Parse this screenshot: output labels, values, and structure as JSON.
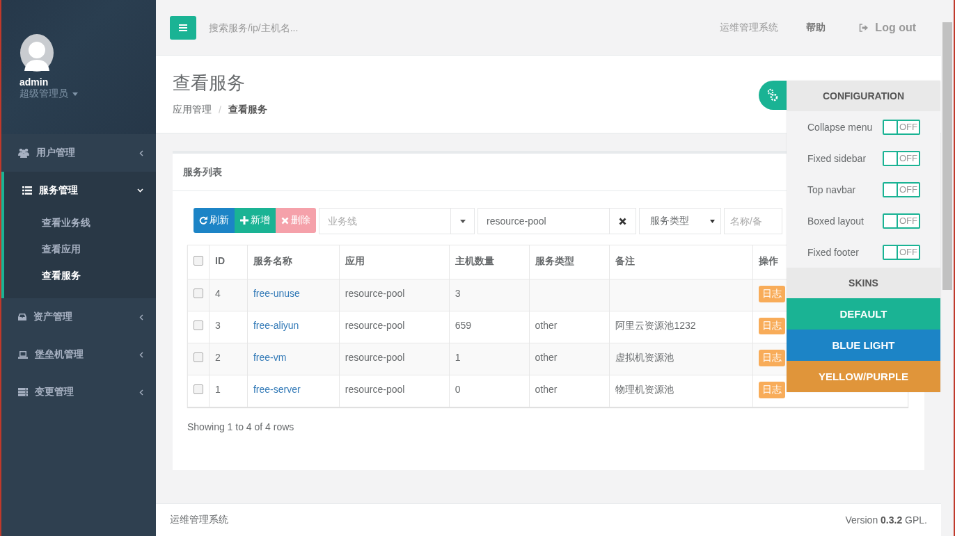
{
  "sidebar": {
    "user": {
      "name": "admin",
      "role": "超级管理员"
    },
    "menu": [
      {
        "label": "用户管理",
        "expanded": false,
        "selected": false
      },
      {
        "label": "服务管理",
        "expanded": true,
        "selected": true,
        "children": [
          {
            "label": "查看业务线",
            "selected": false
          },
          {
            "label": "查看应用",
            "selected": false
          },
          {
            "label": "查看服务",
            "selected": true
          }
        ]
      },
      {
        "label": "资产管理",
        "expanded": false,
        "selected": false
      },
      {
        "label": "堡垒机管理",
        "expanded": false,
        "selected": false
      },
      {
        "label": "变更管理",
        "expanded": false,
        "selected": false
      }
    ]
  },
  "topnav": {
    "search": {
      "placeholder": "搜索服务/ip/主机名..."
    },
    "links": [
      {
        "label": "运维管理系统",
        "kind": "text"
      },
      {
        "label": "帮助",
        "kind": "help"
      }
    ],
    "logout": "Log out"
  },
  "header": {
    "title": "查看服务",
    "separator": "/",
    "breadcrumb": [
      {
        "label": "应用管理",
        "active": false
      },
      {
        "label": "查看服务",
        "active": true
      }
    ]
  },
  "box": {
    "title": "服务列表",
    "buttons": [
      {
        "label": "刷新",
        "kind": "refresh",
        "disabled": false
      },
      {
        "label": "新增",
        "kind": "add",
        "disabled": false
      },
      {
        "label": "删除",
        "kind": "delete",
        "disabled": true
      }
    ],
    "filters": [
      {
        "kind": "combo",
        "placeholder": "业务线"
      },
      {
        "kind": "text",
        "value": "resource-pool"
      },
      {
        "kind": "select",
        "value": "服务类型"
      },
      {
        "kind": "search",
        "placeholder": "名称/备"
      }
    ],
    "table": {
      "all_checked": false,
      "columns": [
        "ID",
        "服务名称",
        "应用",
        "主机数量",
        "服务类型",
        "备注",
        "操作"
      ],
      "rows": [
        {
          "checked": false,
          "id": "4",
          "name": "free-unuse",
          "app": "resource-pool",
          "hosts": "3",
          "type": "",
          "note": "",
          "actions": [
            "日志"
          ]
        },
        {
          "checked": false,
          "id": "3",
          "name": "free-aliyun",
          "app": "resource-pool",
          "hosts": "659",
          "type": "other",
          "note": "阿里云资源池1232",
          "actions": [
            "日志"
          ]
        },
        {
          "checked": false,
          "id": "2",
          "name": "free-vm",
          "app": "resource-pool",
          "hosts": "1",
          "type": "other",
          "note": "虚拟机资源池",
          "actions": [
            "日志"
          ]
        },
        {
          "checked": false,
          "id": "1",
          "name": "free-server",
          "app": "resource-pool",
          "hosts": "0",
          "type": "other",
          "note": "物理机资源池",
          "actions": [
            "日志"
          ]
        }
      ]
    },
    "pagination": "Showing 1 to 4 of 4 rows"
  },
  "footer": {
    "left": "运维管理系统",
    "right": "Version **0.3.2** GPL."
  },
  "config": {
    "title": "CONFIGURATION",
    "options": [
      {
        "label": "Collapse menu",
        "on": false,
        "state_label": "OFF"
      },
      {
        "label": "Fixed sidebar",
        "on": false,
        "state_label": "OFF"
      },
      {
        "label": "Top navbar",
        "on": false,
        "state_label": "OFF"
      },
      {
        "label": "Boxed layout",
        "on": false,
        "state_label": "OFF"
      },
      {
        "label": "Fixed footer",
        "on": false,
        "state_label": "OFF"
      }
    ],
    "skins_title": "SKINS",
    "skins": [
      {
        "label": "DEFAULT",
        "color": "#1ab394"
      },
      {
        "label": "BLUE LIGHT",
        "color": "#1c84c6"
      },
      {
        "label": "YELLOW/PURPLE",
        "color": "#e0953a"
      }
    ]
  }
}
